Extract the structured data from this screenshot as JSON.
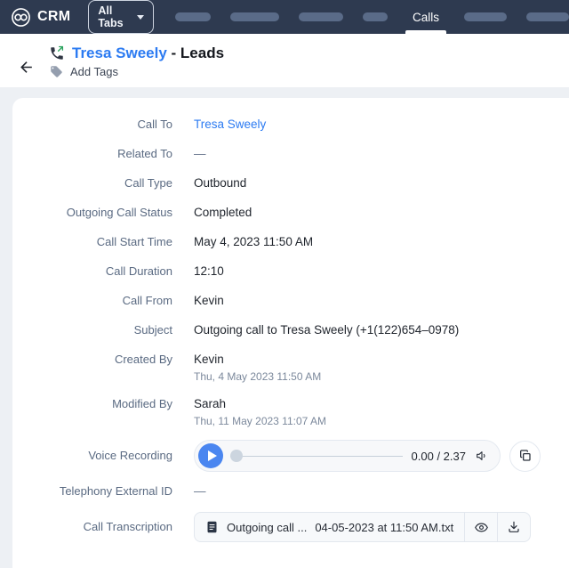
{
  "topbar": {
    "brand": "CRM",
    "all_tabs_label": "All Tabs",
    "active_tab_label": "Calls"
  },
  "header": {
    "record_name": "Tresa Sweely",
    "record_suffix": " - Leads",
    "add_tags_label": "Add Tags"
  },
  "fields": {
    "call_to": {
      "label": "Call To",
      "value": "Tresa Sweely"
    },
    "related_to": {
      "label": "Related To",
      "value": "—"
    },
    "call_type": {
      "label": "Call Type",
      "value": "Outbound"
    },
    "out_status": {
      "label": "Outgoing Call Status",
      "value": "Completed"
    },
    "start_time": {
      "label": "Call Start Time",
      "value": "May 4, 2023 11:50 AM"
    },
    "duration": {
      "label": "Call Duration",
      "value": "12:10"
    },
    "call_from": {
      "label": "Call From",
      "value": "Kevin"
    },
    "subject": {
      "label": "Subject",
      "value": "Outgoing call to Tresa Sweely (+1(122)654–0978)"
    },
    "created_by": {
      "label": "Created By",
      "value": "Kevin",
      "date": "Thu, 4 May 2023 11:50 AM"
    },
    "modified_by": {
      "label": "Modified By",
      "value": "Sarah",
      "date": "Thu, 11 May 2023 11:07 AM"
    },
    "telephony_id": {
      "label": "Telephony External ID",
      "value": "—"
    }
  },
  "voice_recording": {
    "label": "Voice Recording",
    "time_display": "0.00 / 2.37",
    "progress_percent": 0
  },
  "call_transcription": {
    "label": "Call Transcription",
    "file_name_truncated": "Outgoing call ...",
    "file_name_suffix": "04-05-2023 at 11:50 AM.txt"
  },
  "colors": {
    "topbar_bg": "#2e3a50",
    "accent_blue": "#2c7bf2",
    "play_button_blue": "#4a86f0",
    "outgoing_arrow_green": "#27a15b",
    "page_bg": "#edf0f4",
    "label_text": "#5a6a82"
  }
}
